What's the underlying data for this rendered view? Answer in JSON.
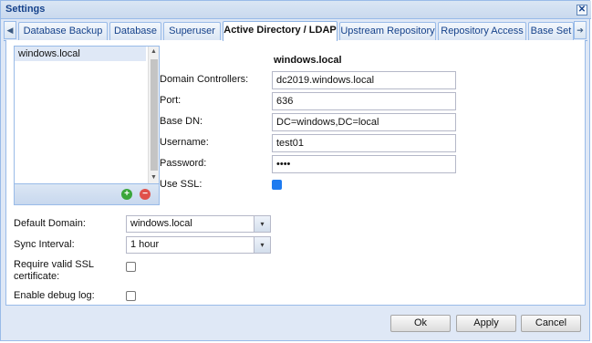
{
  "window": {
    "title": "Settings",
    "close_glyph": "✕"
  },
  "tabs": [
    {
      "label": "Database Backup",
      "active": false
    },
    {
      "label": "Database",
      "active": false
    },
    {
      "label": "Superuser",
      "active": false
    },
    {
      "label": "Active Directory / LDAP",
      "active": true
    },
    {
      "label": "Upstream Repository",
      "active": false
    },
    {
      "label": "Repository Access",
      "active": false
    },
    {
      "label": "Base Set",
      "active": false
    }
  ],
  "tab_scroll": {
    "left_icon": "arrow-left-icon",
    "right_icon": "arrow-right-icon",
    "left_glyph": "◀",
    "right_glyph": "➔"
  },
  "domain_list": {
    "items": [
      "windows.local"
    ],
    "add_icon": "add-circle-icon",
    "remove_icon": "remove-circle-icon",
    "add_glyph": "+",
    "remove_glyph": "−",
    "scroll_up_glyph": "▲",
    "scroll_down_glyph": "▼"
  },
  "domain_form": {
    "heading": "windows.local",
    "domain_controllers_label": "Domain Controllers:",
    "domain_controllers_value": "dc2019.windows.local",
    "port_label": "Port:",
    "port_value": "636",
    "base_dn_label": "Base DN:",
    "base_dn_value": "DC=windows,DC=local",
    "username_label": "Username:",
    "username_value": "test01",
    "password_label": "Password:",
    "password_value": "••••",
    "use_ssl_label": "Use SSL:",
    "use_ssl_checked": true
  },
  "general": {
    "default_domain_label": "Default Domain:",
    "default_domain_value": "windows.local",
    "sync_interval_label": "Sync Interval:",
    "sync_interval_value": "1 hour",
    "require_ssl_label_line1": "Require valid SSL",
    "require_ssl_label_line2": "certificate:",
    "require_ssl_checked": false,
    "debug_log_label": "Enable debug log:",
    "debug_log_checked": false,
    "combo_glyph": "▾"
  },
  "footer": {
    "ok": "Ok",
    "apply": "Apply",
    "cancel": "Cancel"
  },
  "colors": {
    "accent": "#15428b",
    "ssl_checked": "#1e7bf0",
    "frame": "#dfe8f6",
    "border": "#99bbe8"
  }
}
